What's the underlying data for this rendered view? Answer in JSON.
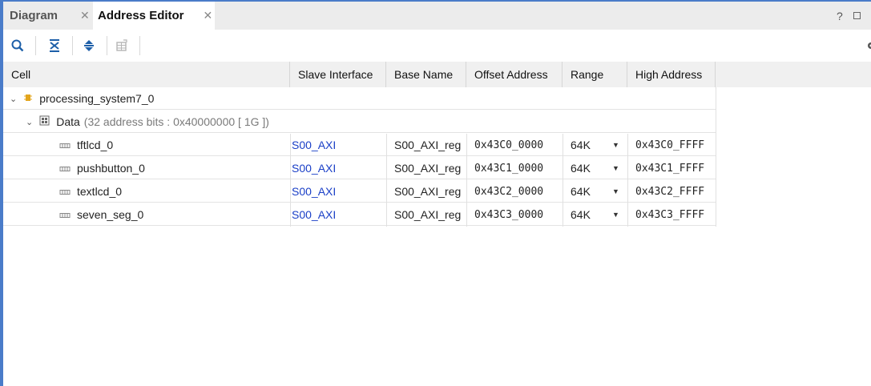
{
  "tabs": [
    {
      "label": "Diagram",
      "active": false
    },
    {
      "label": "Address Editor",
      "active": true
    }
  ],
  "window_controls": {
    "help": "?"
  },
  "toolbar": {
    "icons": [
      "search-icon",
      "collapse-all-icon",
      "expand-all-icon",
      "auto-assign-address-icon"
    ]
  },
  "table": {
    "columns": [
      "Cell",
      "Slave Interface",
      "Base Name",
      "Offset Address",
      "Range",
      "High Address"
    ],
    "root": {
      "label": "processing_system7_0"
    },
    "group": {
      "label": "Data",
      "detail": "(32 address bits : 0x40000000 [ 1G ])"
    },
    "rows": [
      {
        "cell": "tftlcd_0",
        "slave_interface": "S00_AXI",
        "base_name": "S00_AXI_reg",
        "offset": "0x43C0_0000",
        "range": "64K",
        "high": "0x43C0_FFFF"
      },
      {
        "cell": "pushbutton_0",
        "slave_interface": "S00_AXI",
        "base_name": "S00_AXI_reg",
        "offset": "0x43C1_0000",
        "range": "64K",
        "high": "0x43C1_FFFF"
      },
      {
        "cell": "textlcd_0",
        "slave_interface": "S00_AXI",
        "base_name": "S00_AXI_reg",
        "offset": "0x43C2_0000",
        "range": "64K",
        "high": "0x43C2_FFFF"
      },
      {
        "cell": "seven_seg_0",
        "slave_interface": "S00_AXI",
        "base_name": "S00_AXI_reg",
        "offset": "0x43C3_0000",
        "range": "64K",
        "high": "0x43C3_FFFF"
      }
    ]
  },
  "colors": {
    "accent": "#4a7cc9",
    "link": "#1a3fc7",
    "header_bg": "#f0f0f0"
  }
}
